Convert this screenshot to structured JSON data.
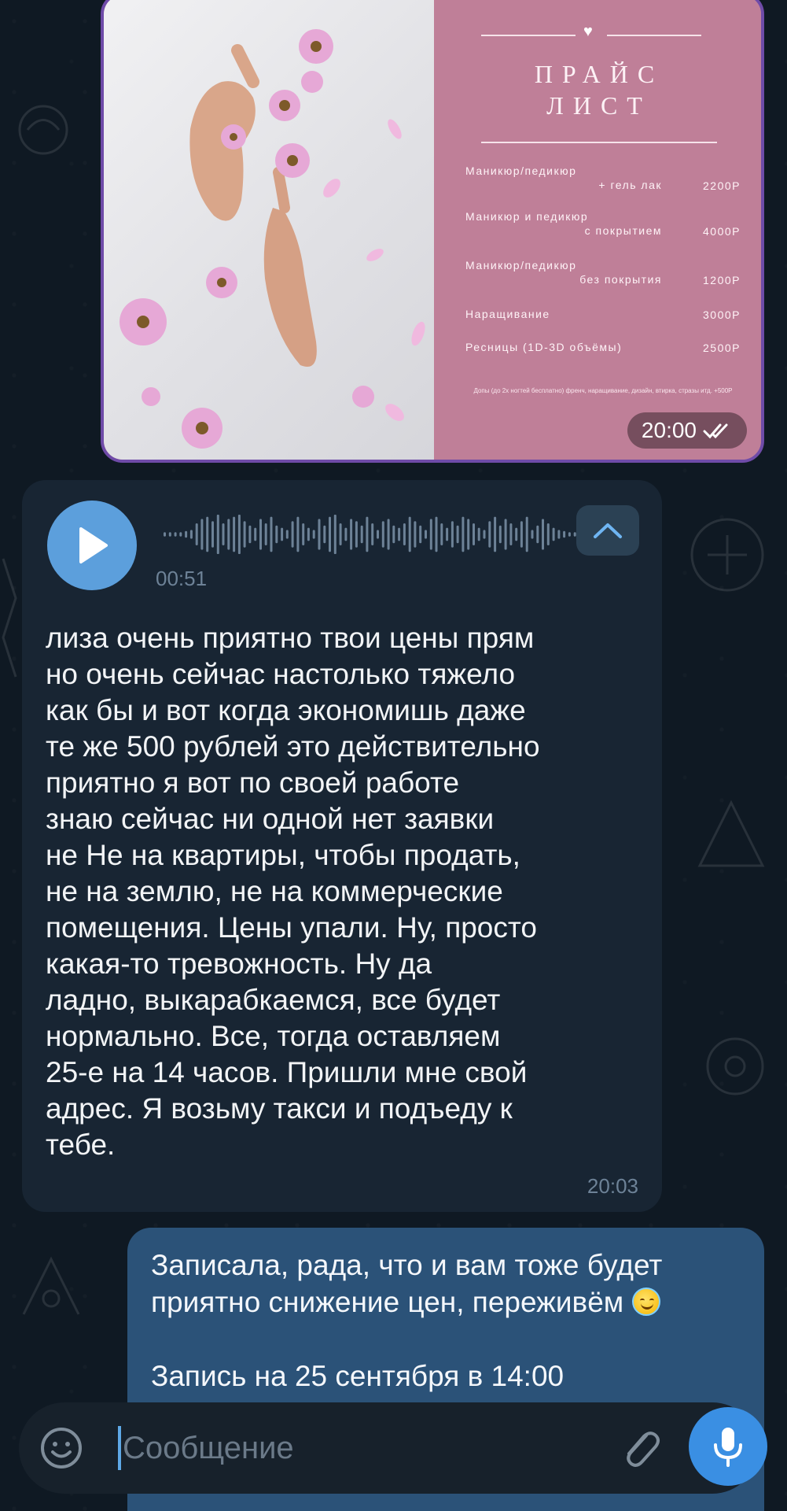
{
  "colors": {
    "background": "#0e1621",
    "incoming_bubble": "#182533",
    "outgoing_bubble": "#2b5278",
    "accent": "#5c9fdc",
    "image_border": "#6f4ba8",
    "price_panel": "#bf7f98"
  },
  "image_message": {
    "price_list": {
      "title_line1": "ПРАЙС",
      "title_line2": "ЛИСТ",
      "items": [
        {
          "line1": "Маникюр/педикюр",
          "line2": "+ гель лак",
          "price": "2200Р"
        },
        {
          "line1": "Маникюр и педикюр",
          "line2": "с покрытием",
          "price": "4000Р"
        },
        {
          "line1": "Маникюр/педикюр",
          "line2": "без покрытия",
          "price": "1200Р"
        },
        {
          "line1": "Наращивание",
          "line2": "",
          "price": "3000Р"
        },
        {
          "line1": "Ресницы (1D-3D объёмы)",
          "line2": "",
          "price": "2500Р"
        }
      ],
      "note": "Допы (до 2х ногтей бесплатно) френч, наращивание, дизайн, втирка, стразы итд. +500Р"
    },
    "time": "20:00",
    "status_icon": "double-check-icon"
  },
  "voice_message": {
    "play_icon": "play-icon",
    "duration": "00:51",
    "collapse_icon": "chevron-up-icon",
    "transcript": "лиза очень приятно твои цены прям\nно очень сейчас настолько тяжело\nкак бы и вот когда экономишь даже\nте же 500 рублей это действительно\nприятно я вот по своей работе\nзнаю сейчас ни одной нет заявки\nне Не на квартиры, чтобы продать,\nне на землю, не на коммерческие\nпомещения. Цены упали. Ну, просто\nкакая-то тревожность. Ну да\nладно, выкарабкаемся, все будет\nнормально. Все, тогда оставляем\n25-е на 14 часов. Пришли мне свой\nадрес. Я возьму такси и подъеду к\nтебе.",
    "time": "20:03"
  },
  "outgoing_message": {
    "text_part1": "Записала, рада, что и вам тоже будет\nприятно снижение цен, переживём ",
    "emoji": "smiling-face-with-halo",
    "text_part2": "\n\nЗапись на 25 сентября в 14:00"
  },
  "input_bar": {
    "placeholder": "Сообщение",
    "emoji_icon": "smiley-icon",
    "attach_icon": "paperclip-icon",
    "mic_icon": "microphone-icon"
  }
}
